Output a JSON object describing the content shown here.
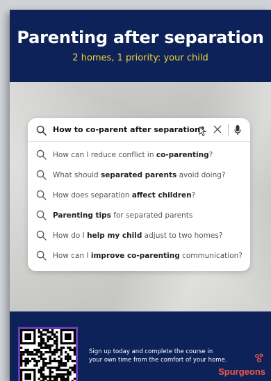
{
  "header": {
    "title": "Parenting after separation",
    "subtitle": "2 homes, 1 priority: your child"
  },
  "search": {
    "query": "How to co-parent after separation?",
    "suggestions": [
      {
        "parts": [
          {
            "t": "How can I reduce conflict in ",
            "b": false
          },
          {
            "t": "co-parenting",
            "b": true
          },
          {
            "t": "?",
            "b": false
          }
        ]
      },
      {
        "parts": [
          {
            "t": "What should ",
            "b": false
          },
          {
            "t": "separated parents",
            "b": true
          },
          {
            "t": " avoid doing?",
            "b": false
          }
        ]
      },
      {
        "parts": [
          {
            "t": "How does separation ",
            "b": false
          },
          {
            "t": "affect children",
            "b": true
          },
          {
            "t": "?",
            "b": false
          }
        ]
      },
      {
        "parts": [
          {
            "t": "Parenting tips",
            "b": true
          },
          {
            "t": " for separated parents",
            "b": false
          }
        ]
      },
      {
        "parts": [
          {
            "t": "How do I ",
            "b": false
          },
          {
            "t": "help my child",
            "b": true
          },
          {
            "t": " adjust to two homes?",
            "b": false
          }
        ]
      },
      {
        "parts": [
          {
            "t": "How can I ",
            "b": false
          },
          {
            "t": "improve co-parenting",
            "b": true
          },
          {
            "t": " communication?",
            "b": false
          }
        ]
      }
    ]
  },
  "footer": {
    "text": "Sign up today and complete the course in your own time from the comfort of your home.",
    "logo": "Spurgeons"
  },
  "colors": {
    "navy": "#0d2258",
    "accent_yellow": "#f4d23a",
    "qr_border": "#6d3db8",
    "logo": "#f05a4a"
  },
  "icons": [
    "search-icon",
    "close-icon",
    "microphone-icon",
    "cursor-icon",
    "qr-code",
    "spurgeons-logo"
  ]
}
